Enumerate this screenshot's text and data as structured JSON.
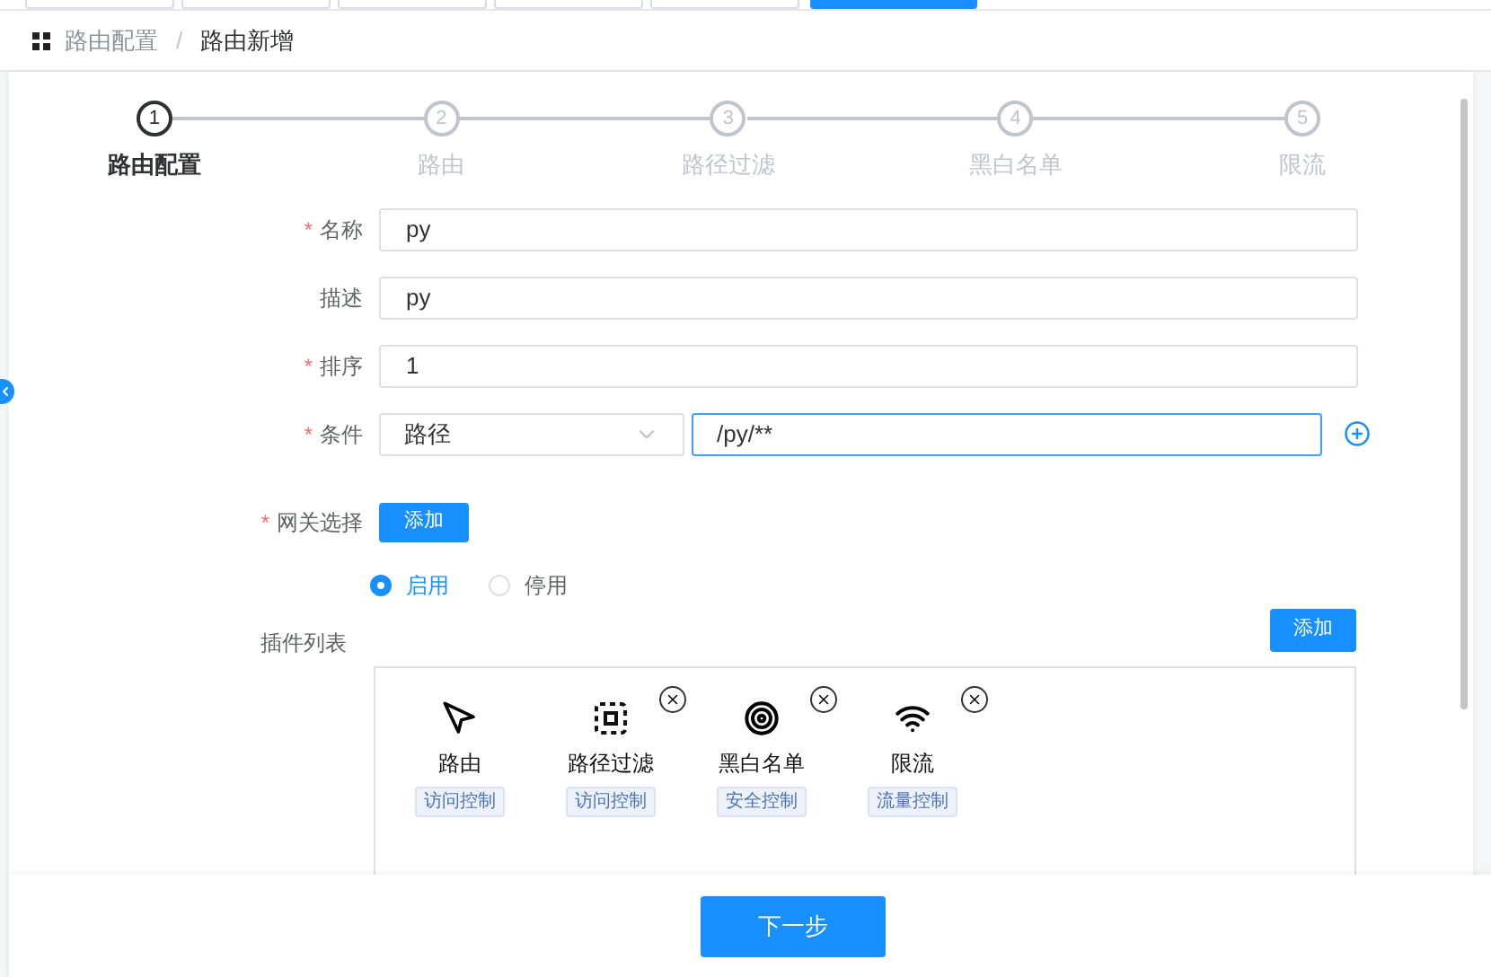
{
  "top_tabs": [
    {
      "selected": false
    },
    {
      "selected": false
    },
    {
      "selected": false
    },
    {
      "selected": false
    },
    {
      "selected": false
    },
    {
      "selected": true
    }
  ],
  "breadcrumb": [
    "路由配置",
    "路由新增"
  ],
  "breadcrumb_separator": "/",
  "required_mark": "*",
  "steps": [
    {
      "number": "1",
      "label": "路由配置",
      "current": true
    },
    {
      "number": "2",
      "label": "路由",
      "current": false
    },
    {
      "number": "3",
      "label": "路径过滤",
      "current": false
    },
    {
      "number": "4",
      "label": "黑白名单",
      "current": false
    },
    {
      "number": "5",
      "label": "限流",
      "current": false
    }
  ],
  "form": [
    {
      "kind": "text",
      "label": "名称",
      "required": true,
      "value": "py"
    },
    {
      "kind": "text",
      "label": "描述",
      "required": false,
      "value": "py"
    },
    {
      "kind": "text",
      "label": "排序",
      "required": true,
      "value": "1"
    },
    {
      "kind": "condition",
      "label": "条件",
      "required": true,
      "select": "路径",
      "value": "/py/**",
      "focused": true
    },
    {
      "kind": "button",
      "label": "网关选择",
      "required": true,
      "button": "添加"
    }
  ],
  "status_options": [
    {
      "label": "启用",
      "selected": true
    },
    {
      "label": "停用",
      "selected": false
    }
  ],
  "plugins": {
    "label": "插件列表",
    "add_button": "添加",
    "items": [
      {
        "name": "路由",
        "tag": "访问控制",
        "removable": false
      },
      {
        "name": "路径过滤",
        "tag": "访问控制",
        "removable": true
      },
      {
        "name": "黑白名单",
        "tag": "安全控制",
        "removable": true
      },
      {
        "name": "限流",
        "tag": "流量控制",
        "removable": true
      }
    ]
  },
  "next_button": "下一步"
}
